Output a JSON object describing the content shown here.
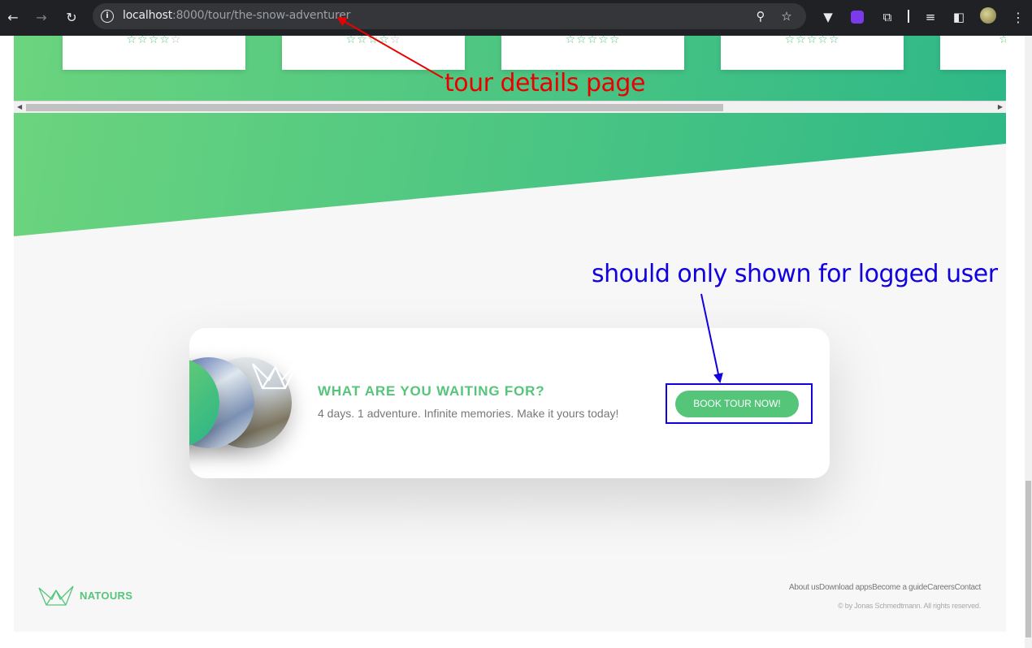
{
  "browser": {
    "url_host": "localhost",
    "url_rest": ":8000/tour/the-snow-adventurer",
    "back_icon": "←",
    "forward_icon": "→",
    "reload_icon": "↻",
    "info_icon": "i",
    "zoom_icon": "⚲",
    "star_icon": "☆",
    "extensions": [
      "vuetify-icon",
      "ext-purple-icon",
      "puzzle-icon",
      "media-icon",
      "sidepanel-icon"
    ],
    "menu_icon": "⋮"
  },
  "reviews": {
    "cards": [
      {
        "stars": "☆☆☆☆",
        "empty": "☆"
      },
      {
        "stars": "☆☆☆☆",
        "empty": "☆"
      },
      {
        "stars": "☆☆☆☆☆",
        "empty": ""
      },
      {
        "stars": "☆☆☆☆☆",
        "empty": ""
      },
      {
        "stars": "☆",
        "empty": ""
      }
    ]
  },
  "cta": {
    "title": "WHAT ARE YOU WAITING FOR?",
    "text": "4 days. 1 adventure. Infinite memories. Make it yours today!",
    "button": "BOOK TOUR NOW!"
  },
  "footer": {
    "brand": "NATOURS",
    "nav": [
      "About us",
      "Download apps",
      "Become a guide",
      "Careers",
      "Contact"
    ],
    "copyright": "© by Jonas Schmedtmann. All rights reserved."
  },
  "annotations": {
    "tour_details": "tour details page",
    "logged_user": "should only shown for logged user"
  },
  "colors": {
    "brand_green": "#55c57a",
    "annotation_red": "#ea0000",
    "annotation_blue": "#1100e0"
  }
}
